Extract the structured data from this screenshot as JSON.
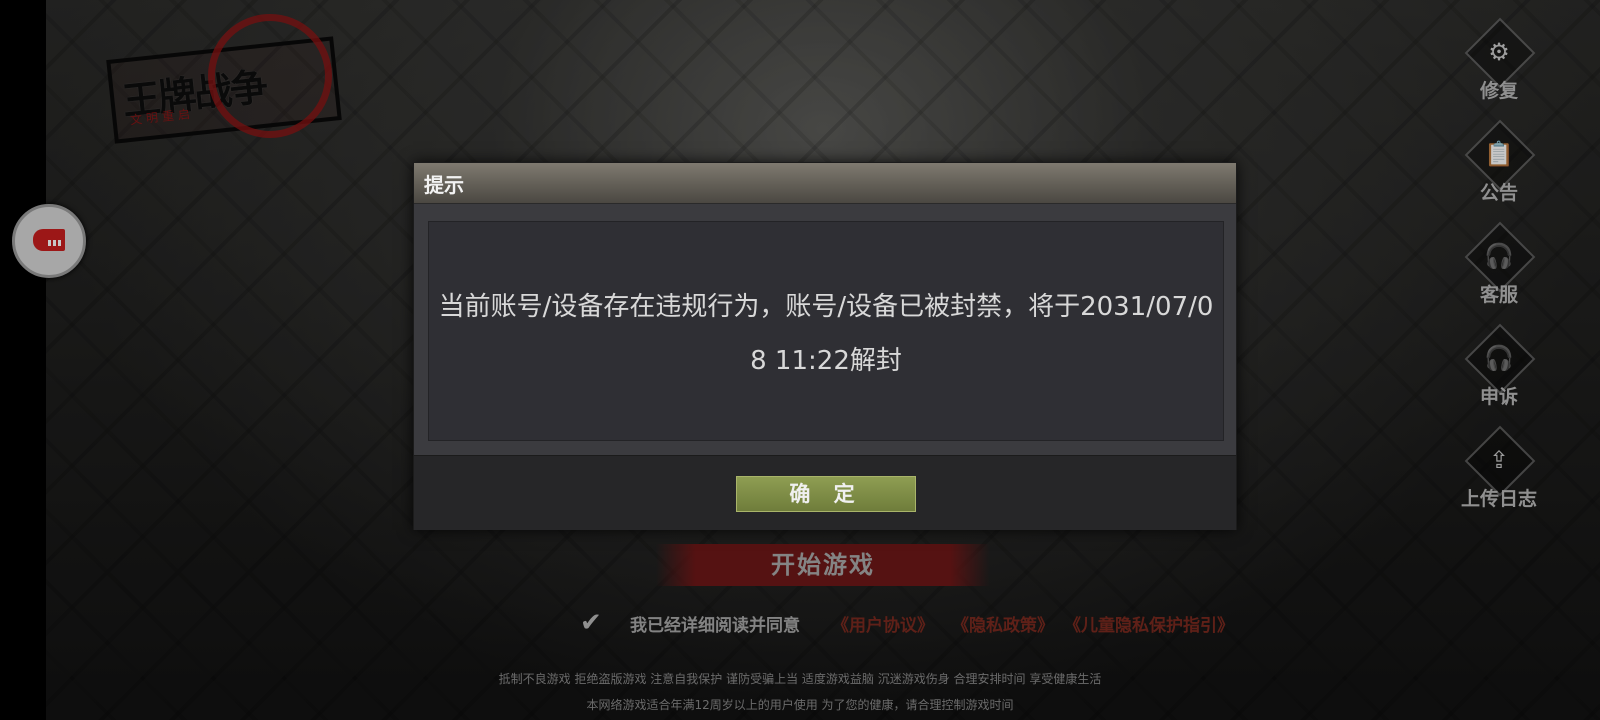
{
  "logo": {
    "title": "王牌战争",
    "subtitle": "文明重启"
  },
  "side_menu": [
    {
      "label": "修复",
      "icon": "gear-icon"
    },
    {
      "label": "公告",
      "icon": "clipboard-icon"
    },
    {
      "label": "客服",
      "icon": "headset-icon"
    },
    {
      "label": "申诉",
      "icon": "headset-icon"
    },
    {
      "label": "上传日志",
      "icon": "upload-icon"
    }
  ],
  "dialog": {
    "title": "提示",
    "message": "当前账号/设备存在违规行为，账号/设备已被封禁，将于2031/07/08 11:22解封",
    "confirm_label": "确 定"
  },
  "start_button": "开始游戏",
  "agreement": {
    "text": "我已经详细阅读并同意",
    "links": [
      "《用户协议》",
      "《隐私政策》",
      "《儿童隐私保护指引》"
    ],
    "checked": true
  },
  "health_notice": {
    "line1": "抵制不良游戏 拒绝盗版游戏 注意自我保护 谨防受骗上当 适度游戏益脑 沉迷游戏伤身 合理安排时间 享受健康生活",
    "line2": "本网络游戏适合年满12周岁以上的用户使用    为了您的健康，请合理控制游戏时间"
  },
  "colors": {
    "confirm_green": "#7d8c47",
    "start_red": "#6e1818",
    "link_red": "#7a2a1f"
  }
}
